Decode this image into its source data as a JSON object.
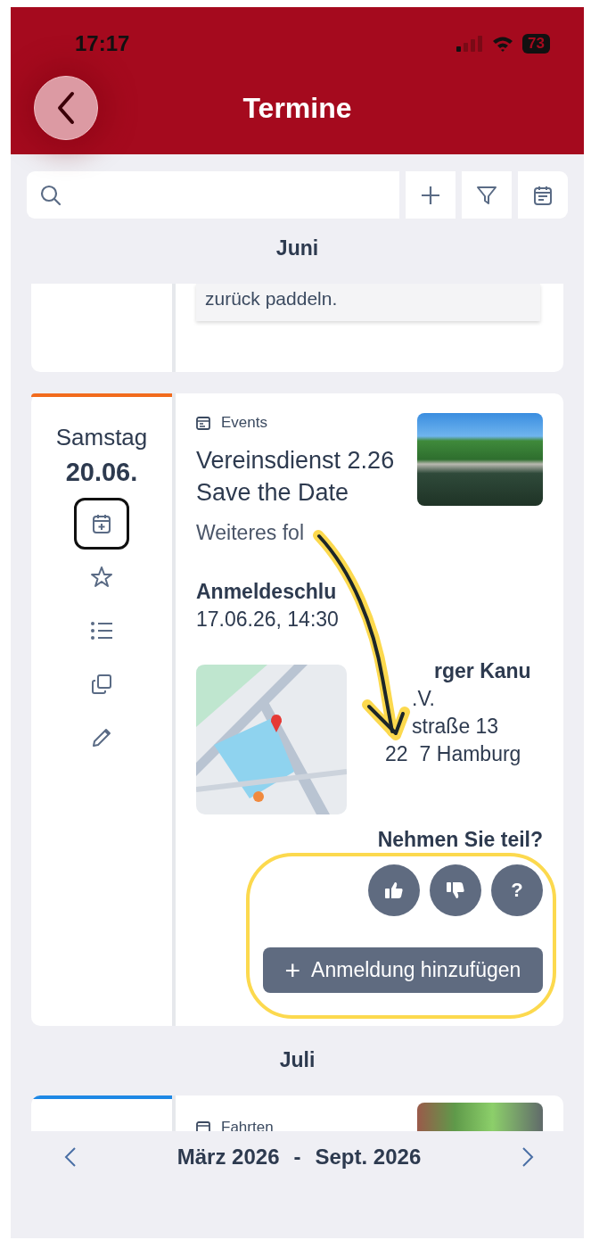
{
  "status_bar": {
    "time": "17:17",
    "battery": "73"
  },
  "header": {
    "title": "Termine"
  },
  "toolbar": {
    "buttons": [
      {
        "kind": "add"
      },
      {
        "kind": "filter"
      },
      {
        "kind": "calendar"
      }
    ]
  },
  "sections": [
    {
      "month": "Juni",
      "events": [
        {
          "kind": "cut-top",
          "note": "zurück paddeln."
        },
        {
          "kind": "full",
          "color": "#f26b1d",
          "weekday": "Samstag",
          "date": "20.06.",
          "actions": [
            {
              "kind": "calendar-add",
              "selected": true
            },
            {
              "kind": "star",
              "selected": false
            },
            {
              "kind": "list",
              "selected": false
            },
            {
              "kind": "copy",
              "selected": false
            },
            {
              "kind": "edit",
              "selected": false
            }
          ],
          "category": "Events",
          "title": [
            "Vereinsdienst 2.26",
            "Save the Date"
          ],
          "description": "Weiteres fol",
          "deadline_label": "Anmeldeschlu",
          "deadline": "17.06.26, 14:30",
          "address": [
            [
              "rger Kanu"
            ],
            [
              ".V."
            ],
            [
              "straße 13"
            ],
            [
              "22",
              "7 Hamburg"
            ]
          ],
          "question": "Nehmen Sie teil?",
          "responses": [
            {
              "kind": "yes"
            },
            {
              "kind": "no"
            },
            {
              "kind": "maybe",
              "label": "?"
            }
          ],
          "add_button": {
            "icon": "+",
            "label": "Anmeldung hinzufügen"
          }
        }
      ]
    },
    {
      "month": "Juli",
      "events": [
        {
          "kind": "cut-bottom",
          "color": "#1e88e5",
          "category": "Fahrten"
        }
      ]
    }
  ],
  "footer": {
    "range_start": "März 2026",
    "separator": "-",
    "range_end": "Sept. 2026"
  }
}
